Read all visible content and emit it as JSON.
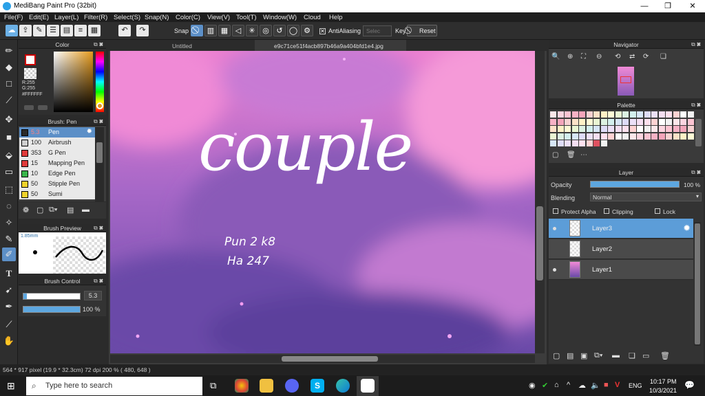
{
  "window": {
    "title": "MediBang Paint Pro (32bit)",
    "minimize": "—",
    "restore": "❐",
    "close": "✕"
  },
  "menu": [
    "File(F)",
    "Edit(E)",
    "Layer(L)",
    "Filter(R)",
    "Select(S)",
    "Snap(N)",
    "Color(C)",
    "View(V)",
    "Tool(T)",
    "Window(W)",
    "Cloud",
    "Help"
  ],
  "toolbar": {
    "snap_label": "Snap",
    "antialiasing_label": "AntiAliasing",
    "antialiasing_checked": true,
    "key_label": "Key",
    "reset_label": "Reset",
    "dim_field_placeholder": "Selec"
  },
  "color_panel": {
    "title": "Color",
    "rgb_r": "R:255",
    "rgb_g": "G:255",
    "hex": "#FFFFFF",
    "primary_color": "#ffffff",
    "secondary_color": "#cc0000"
  },
  "brush_panel": {
    "title": "Brush: Pen",
    "brushes": [
      {
        "size": "5.3",
        "name": "Pen",
        "color": "#2a2a2a",
        "selected": true
      },
      {
        "size": "100",
        "name": "Airbrush",
        "color": "#cfcfcf",
        "selected": false
      },
      {
        "size": "353",
        "name": "G Pen",
        "color": "#e03a3a",
        "selected": false
      },
      {
        "size": "15",
        "name": "Mapping Pen",
        "color": "#e03a3a",
        "selected": false
      },
      {
        "size": "10",
        "name": "Edge Pen",
        "color": "#39b54a",
        "selected": false
      },
      {
        "size": "50",
        "name": "Stipple Pen",
        "color": "#f0d22b",
        "selected": false
      },
      {
        "size": "50",
        "name": "Sumi",
        "color": "#f0d22b",
        "selected": false
      }
    ]
  },
  "brush_preview": {
    "title": "Brush Preview",
    "size_label": "1.85mm"
  },
  "brush_control": {
    "title": "Brush Control",
    "size_value": "5.3",
    "opacity_value": "100 %",
    "size_fraction": 0.06,
    "opacity_fraction": 1.0
  },
  "doc_tabs": [
    "Untitled",
    "e9c71ce51f4acb897b46a9a404bfd1e4.jpg"
  ],
  "artwork": {
    "main_text": "couple",
    "signature_line1": "Pun 2 k8",
    "signature_line2": "Ha 247"
  },
  "navigator": {
    "title": "Navigator"
  },
  "palette": {
    "title": "Palette"
  },
  "layer_panel": {
    "title": "Layer",
    "opacity_label": "Opacity",
    "opacity_value": "100 %",
    "blending_label": "Blending",
    "blending_value": "Normal",
    "protect_alpha": "Protect Alpha",
    "clipping": "Clipping",
    "lock": "Lock",
    "layers": [
      {
        "name": "Layer3",
        "selected": true,
        "visible": true
      },
      {
        "name": "Layer2",
        "selected": false,
        "visible": false
      },
      {
        "name": "Layer1",
        "selected": false,
        "visible": true
      }
    ]
  },
  "status": {
    "info": "564 * 917 pixel   (19.9 * 32.3cm)   72 dpi   200 %   ( 480, 648 )"
  },
  "taskbar": {
    "search_placeholder": "Type here to search",
    "time": "10:17 PM",
    "date": "10/3/2021",
    "lang": "ENG"
  }
}
